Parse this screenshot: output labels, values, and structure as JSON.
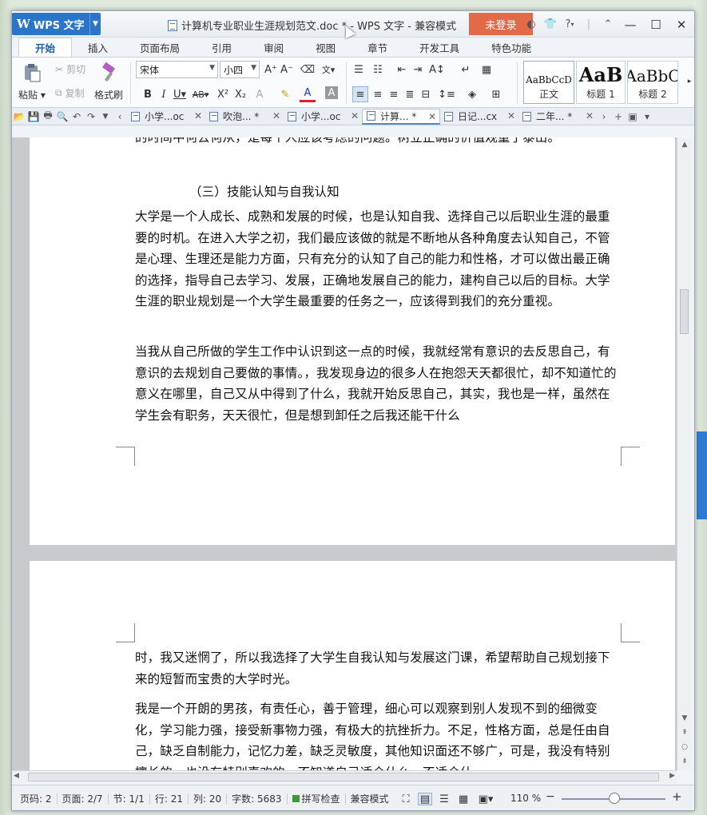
{
  "app": {
    "menu_label": "WPS 文字",
    "title": "计算机专业职业生涯规划范文.doc * - WPS 文字 - 兼容模式",
    "login_label": "未登录",
    "help_label": "?"
  },
  "ribbon_tabs": [
    "开始",
    "插入",
    "页面布局",
    "引用",
    "审阅",
    "视图",
    "章节",
    "开发工具",
    "特色功能"
  ],
  "ribbon": {
    "paste": "粘贴",
    "cut": "剪切",
    "copy": "复制",
    "format_painter": "格式刷",
    "font_name": "宋体",
    "font_size": "小四",
    "styles": [
      {
        "sample": "AaBbCcD",
        "label": "正文"
      },
      {
        "sample": "AaB",
        "label": "标题 1"
      },
      {
        "sample": "AaBbC",
        "label": "标题 2"
      }
    ]
  },
  "doc_tabs": [
    {
      "label": "小学...oc",
      "active": false
    },
    {
      "label": "吹泡... *",
      "active": false
    },
    {
      "label": "小学...oc",
      "active": false
    },
    {
      "label": "计算... *",
      "active": true
    },
    {
      "label": "日记...cx",
      "active": false
    },
    {
      "label": "二年... *",
      "active": false
    }
  ],
  "document": {
    "line_top": "的时间中何去何从，是每个人应该考虑的问题。树立正确的价值观重于泰山。",
    "heading": "（三）技能认知与自我认知",
    "para1": "大学是一个人成长、成熟和发展的时候，也是认知自我、选择自己以后职业生涯的最重要的时机。在进入大学之初，我们最应该做的就是不断地从各种角度去认知自己，不管是心理、生理还是能力方面，只有充分的认知了自己的能力和性格，才可以做出最正确的选择，指导自己去学习、发展，正确地发展自己的能力，建构自己以后的目标。大学生涯的职业规划是一个大学生最重要的任务之一，应该得到我们的充分重视。",
    "para2": "当我从自己所做的学生工作中认识到这一点的时候，我就经常有意识的去反思自己，有意识的去规划自己要做的事情。，我发现身边的很多人在抱怨天天都很忙，却不知道忙的意义在哪里，自己又从中得到了什么，我就开始反思自己，其实，我也是一样，虽然在学生会有职务，天天很忙，但是想到卸任之后我还能干什么",
    "para3": "时，我又迷惘了，所以我选择了大学生自我认知与发展这门课，希望帮助自己规划接下来的短暂而宝贵的大学时光。",
    "para4": "我是一个开朗的男孩，有责任心，善于管理，细心可以观察到别人发现不到的细微变化，学习能力强，接受新事物力强，有极大的抗挫折力。不足，性格方面，总是任由自己，缺乏自制能力，记忆力差，缺乏灵敏度，其他知识面还不够广，可是，我没有特别擅长的，也没有特别喜欢的，不知道自己适合什么，不适合什"
  },
  "status": {
    "page_code": "页码: 2",
    "pages": "页面: 2/7",
    "section": "节: 1/1",
    "row": "行: 21",
    "col": "列: 20",
    "word_count": "字数: 5683",
    "spell_check": "拼写检查",
    "compat_mode": "兼容模式",
    "zoom": "110 %"
  }
}
